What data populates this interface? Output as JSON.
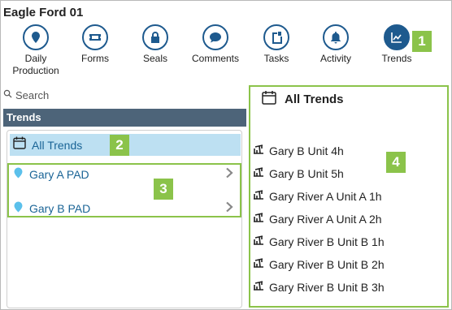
{
  "app": {
    "title": "Eagle Ford 01"
  },
  "toolbar": {
    "items": [
      {
        "label": "Daily Production",
        "icon": "map-pin-icon"
      },
      {
        "label": "Forms",
        "icon": "ticket-icon"
      },
      {
        "label": "Seals",
        "icon": "lock-icon"
      },
      {
        "label": "Comments",
        "icon": "chat-bubble-icon"
      },
      {
        "label": "Tasks",
        "icon": "clipboard-icon"
      },
      {
        "label": "Activity",
        "icon": "bell-icon"
      },
      {
        "label": "Trends",
        "icon": "trend-chart-icon",
        "active": true
      }
    ]
  },
  "search": {
    "placeholder": "Search"
  },
  "left_panel": {
    "header": "Trends",
    "all_trends_label": "All Trends",
    "pads": [
      {
        "label": "Gary A PAD"
      },
      {
        "label": "Gary B PAD"
      }
    ]
  },
  "right_panel": {
    "title": "All Trends",
    "items": [
      "Gary B Unit 4h",
      "Gary B Unit 5h",
      "Gary River A Unit A 1h",
      "Gary River A Unit A 2h",
      "Gary River B Unit B 1h",
      "Gary River B Unit B 2h",
      "Gary River B Unit B 3h"
    ]
  },
  "callouts": [
    "1",
    "2",
    "3",
    "4"
  ],
  "colors": {
    "accent": "#1e5a8e",
    "highlight": "#bde0f2",
    "header": "#4d6479",
    "callout": "#8bc34a",
    "link": "#1a6496"
  }
}
